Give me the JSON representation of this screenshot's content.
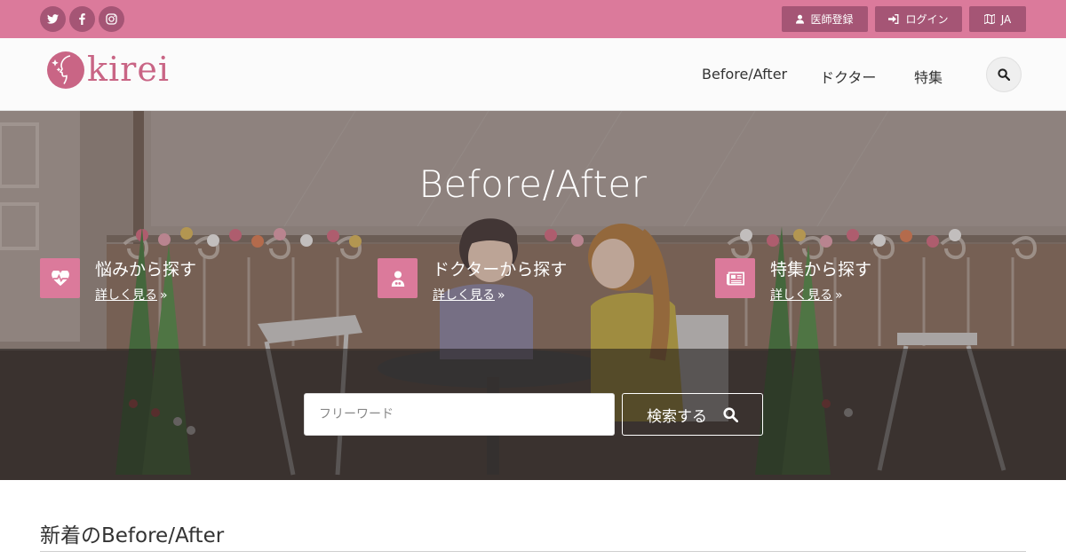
{
  "colors": {
    "brand_pink": "#db7a9b",
    "button_dark_pink": "#a55575",
    "logo_pink": "#c96585"
  },
  "topbar": {
    "social": [
      {
        "icon": "twitter-icon"
      },
      {
        "icon": "facebook-icon"
      },
      {
        "icon": "instagram-icon"
      }
    ],
    "doctor_register_label": "医師登録",
    "login_label": "ログイン",
    "language_label": "JA"
  },
  "header": {
    "logo_text": "kirei",
    "nav": [
      "Before/After",
      "ドクター",
      "特集"
    ],
    "search_icon": "search-icon"
  },
  "hero": {
    "title": "Before/After",
    "features": [
      {
        "icon": "heartbeat-icon",
        "title": "悩みから探す",
        "link": "詳しく見る",
        "arrow": "»"
      },
      {
        "icon": "doctor-icon",
        "title": "ドクターから探す",
        "link": "詳しく見る",
        "arrow": "»"
      },
      {
        "icon": "newspaper-icon",
        "title": "特集から探す",
        "link": "詳しく見る",
        "arrow": "»"
      }
    ],
    "search": {
      "placeholder": "フリーワード",
      "value": "",
      "button_label": "検索する"
    }
  },
  "section": {
    "title": "新着のBefore/After"
  }
}
